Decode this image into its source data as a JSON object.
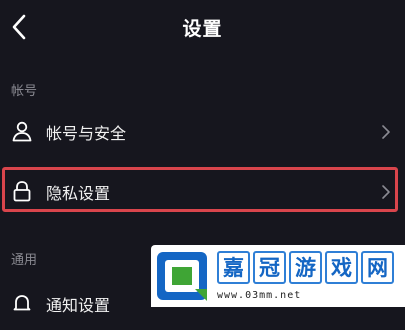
{
  "header": {
    "title": "设置",
    "back_icon": "chevron-left-icon"
  },
  "sections": [
    {
      "label": "帐号",
      "items": [
        {
          "label": "帐号与安全",
          "icon": "user-icon"
        },
        {
          "label": "隐私设置",
          "icon": "lock-icon",
          "highlighted": true
        }
      ]
    },
    {
      "label": "通用",
      "items": [
        {
          "label": "通知设置",
          "icon": "bell-icon"
        }
      ]
    }
  ],
  "watermark": {
    "chars": [
      "嘉",
      "冠",
      "游",
      "戏",
      "网"
    ],
    "url": "www.03mm.net"
  },
  "colors": {
    "background": "#16161e",
    "highlight_border": "#d9454c",
    "section_label": "#8a8a92",
    "watermark_blue": "#1466c4",
    "watermark_green": "#3fa535"
  }
}
